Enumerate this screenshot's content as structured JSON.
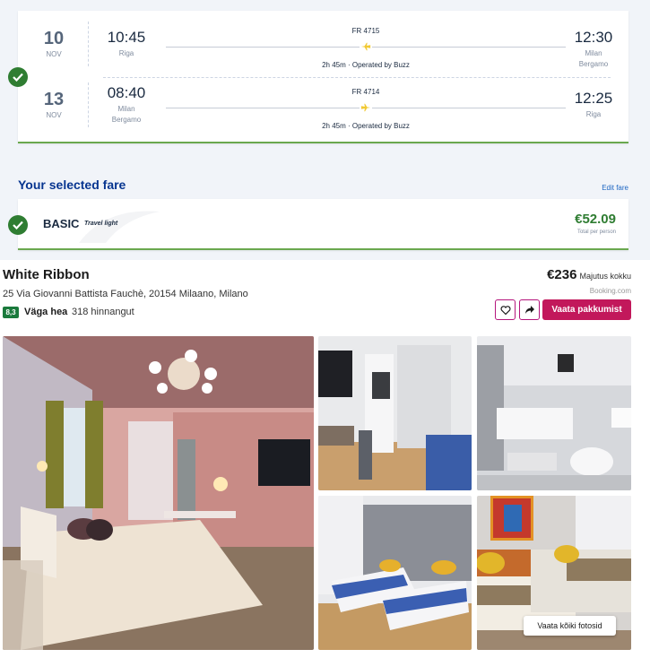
{
  "flights": [
    {
      "day": "10",
      "month": "NOV",
      "departure_time": "10:45",
      "departure_place": "Riga",
      "flight_number": "FR 4715",
      "duration_info": "2h 45m · Operated by Buzz",
      "arrival_time": "12:30",
      "arrival_place_line1": "Milan",
      "arrival_place_line2": "Bergamo"
    },
    {
      "day": "13",
      "month": "NOV",
      "departure_time": "08:40",
      "departure_place_line1": "Milan",
      "departure_place_line2": "Bergamo",
      "flight_number": "FR 4714",
      "duration_info": "2h 45m · Operated by Buzz",
      "arrival_time": "12:25",
      "arrival_place": "Riga"
    }
  ],
  "fare": {
    "section_title": "Your selected fare",
    "edit_label": "Edit fare",
    "name": "BASIC",
    "subtitle": "Travel light",
    "price": "€52.09",
    "price_note": "Total per person"
  },
  "hotel": {
    "name": "White Ribbon",
    "address": "25 Via Giovanni Battista Fauchè, 20154 Milaano, Milano",
    "score": "8,3",
    "score_label": "Väga hea",
    "review_count": "318 hinnangut",
    "price": "€236",
    "price_note": "Majutus kokku",
    "provider": "Booking.com",
    "deals_button": "Vaata pakkumist",
    "view_all_photos": "Vaata kõiki fotosid"
  },
  "colors": {
    "brand_blue": "#073590",
    "success_green": "#2f7d32",
    "accent_pink": "#c2185b",
    "ryanair_yellow": "#f1c933"
  },
  "icons": [
    "check-circle-icon",
    "plane-icon",
    "heart-icon",
    "share-icon"
  ]
}
